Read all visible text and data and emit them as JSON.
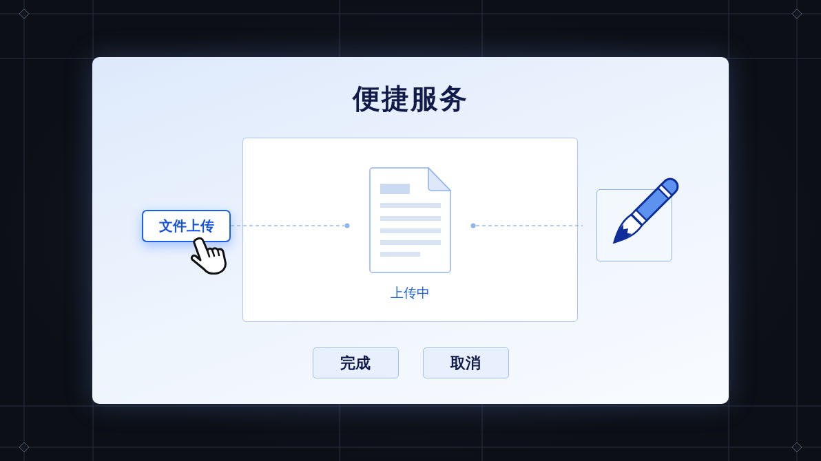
{
  "dialog": {
    "title": "便捷服务",
    "upload_button": {
      "label": "文件上传"
    },
    "upload_panel": {
      "status": "上传中"
    },
    "buttons": [
      {
        "label": "完成"
      },
      {
        "label": "取消"
      }
    ]
  }
}
